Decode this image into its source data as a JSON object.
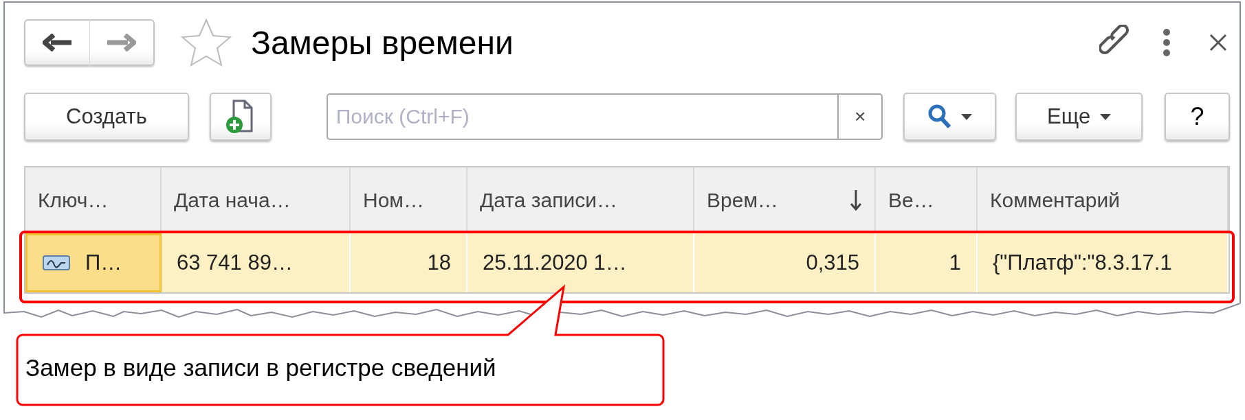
{
  "window": {
    "title": "Замеры времени",
    "favorite": false
  },
  "toolbar": {
    "create_button": "Создать",
    "search": {
      "placeholder": "Поиск (Ctrl+F)",
      "clear": "×"
    },
    "more_button": "Еще",
    "help_button": "?"
  },
  "table": {
    "columns": [
      {
        "label": "Ключ…",
        "sorted_descending": false
      },
      {
        "label": "Дата нача…",
        "sorted_descending": false
      },
      {
        "label": "Ном…",
        "sorted_descending": false
      },
      {
        "label": "Дата записи…",
        "sorted_descending": false
      },
      {
        "label": "Врем…",
        "sorted_descending": true
      },
      {
        "label": "Ве…",
        "sorted_descending": false
      },
      {
        "label": "Комментарий",
        "sorted_descending": false
      }
    ],
    "rows": [
      {
        "selected": true,
        "highlighted": true,
        "cells": [
          {
            "text": "П…",
            "kind": "key",
            "current": true,
            "numeric": false
          },
          {
            "text": "63 741 89…",
            "kind": "text",
            "current": false,
            "numeric": false
          },
          {
            "text": "18",
            "kind": "text",
            "current": false,
            "numeric": true
          },
          {
            "text": "25.11.2020 1…",
            "kind": "text",
            "current": false,
            "numeric": false
          },
          {
            "text": "0,315",
            "kind": "text",
            "current": false,
            "numeric": true
          },
          {
            "text": "1",
            "kind": "text",
            "current": false,
            "numeric": true
          },
          {
            "text": "{\"Платф\":\"8.3.17.1",
            "kind": "text",
            "current": false,
            "numeric": false
          }
        ]
      }
    ]
  },
  "callout": {
    "text": "Замер в виде записи в регистре сведений"
  }
}
